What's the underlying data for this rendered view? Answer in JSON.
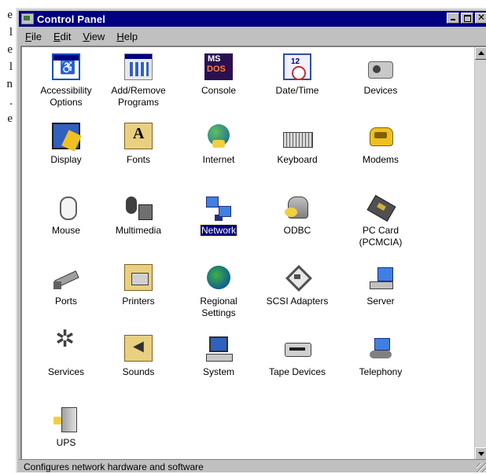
{
  "window": {
    "title": "Control Panel"
  },
  "menu": [
    "File",
    "Edit",
    "View",
    "Help"
  ],
  "side_text": [
    "e",
    "l",
    "e",
    "l",
    "n",
    ".",
    "e"
  ],
  "items": [
    {
      "name": "accessibility-options",
      "label": "Accessibility Options",
      "icon": "accessibility-icon",
      "selected": false
    },
    {
      "name": "add-remove-programs",
      "label": "Add/Remove Programs",
      "icon": "add-remove-programs-icon",
      "selected": false
    },
    {
      "name": "console",
      "label": "Console",
      "icon": "ms-dos-console-icon",
      "selected": false
    },
    {
      "name": "date-time",
      "label": "Date/Time",
      "icon": "calendar-clock-icon",
      "selected": false
    },
    {
      "name": "devices",
      "label": "Devices",
      "icon": "devices-icon",
      "selected": false
    },
    {
      "name": "display",
      "label": "Display",
      "icon": "display-icon",
      "selected": false
    },
    {
      "name": "fonts",
      "label": "Fonts",
      "icon": "fonts-folder-icon",
      "selected": false
    },
    {
      "name": "internet",
      "label": "Internet",
      "icon": "globe-icon",
      "selected": false
    },
    {
      "name": "keyboard",
      "label": "Keyboard",
      "icon": "keyboard-icon",
      "selected": false
    },
    {
      "name": "modems",
      "label": "Modems",
      "icon": "telephone-modem-icon",
      "selected": false
    },
    {
      "name": "mouse",
      "label": "Mouse",
      "icon": "mouse-icon",
      "selected": false
    },
    {
      "name": "multimedia",
      "label": "Multimedia",
      "icon": "multimedia-icon",
      "selected": false
    },
    {
      "name": "network",
      "label": "Network",
      "icon": "network-computers-icon",
      "selected": true
    },
    {
      "name": "odbc",
      "label": "ODBC",
      "icon": "database-icon",
      "selected": false
    },
    {
      "name": "pc-card",
      "label": "PC Card (PCMCIA)",
      "icon": "pc-card-icon",
      "selected": false
    },
    {
      "name": "ports",
      "label": "Ports",
      "icon": "port-cable-icon",
      "selected": false
    },
    {
      "name": "printers",
      "label": "Printers",
      "icon": "printers-folder-icon",
      "selected": false
    },
    {
      "name": "regional-settings",
      "label": "Regional Settings",
      "icon": "globe-icon",
      "selected": false
    },
    {
      "name": "scsi-adapters",
      "label": "SCSI Adapters",
      "icon": "scsi-icon",
      "selected": false
    },
    {
      "name": "server",
      "label": "Server",
      "icon": "server-icon",
      "selected": false
    },
    {
      "name": "services",
      "label": "Services",
      "icon": "gears-icon",
      "selected": false
    },
    {
      "name": "sounds",
      "label": "Sounds",
      "icon": "speaker-folder-icon",
      "selected": false
    },
    {
      "name": "system",
      "label": "System",
      "icon": "computer-icon",
      "selected": false
    },
    {
      "name": "tape-devices",
      "label": "Tape Devices",
      "icon": "tape-drive-icon",
      "selected": false
    },
    {
      "name": "telephony",
      "label": "Telephony",
      "icon": "telephony-icon",
      "selected": false
    },
    {
      "name": "ups",
      "label": "UPS",
      "icon": "ups-battery-icon",
      "selected": false
    }
  ],
  "status": {
    "text": "Configures network hardware and software"
  },
  "colors": {
    "titlebar": "#000080",
    "selection": "#000080",
    "chrome": "#c0c0c0"
  }
}
